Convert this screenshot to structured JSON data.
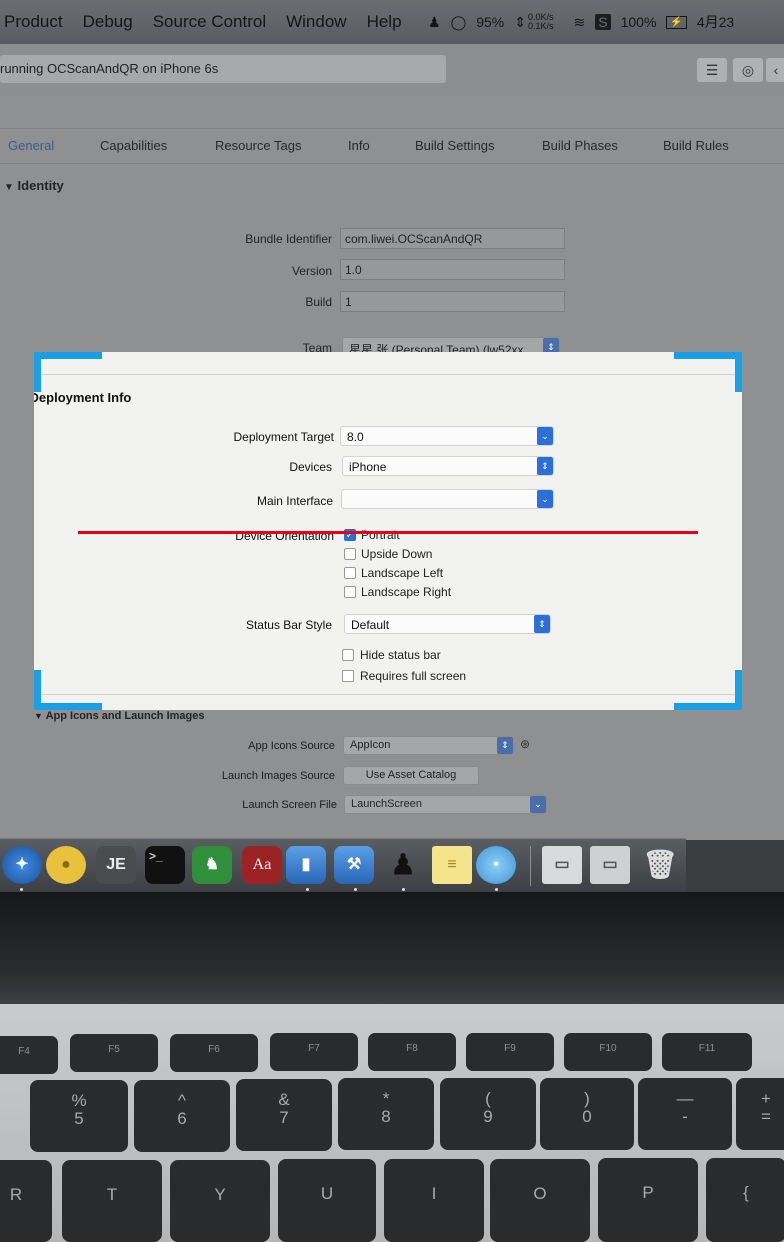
{
  "menubar": {
    "items": [
      "Product",
      "Debug",
      "Source Control",
      "Window",
      "Help"
    ],
    "battery_status": "95%",
    "net_up": "0.0K/s",
    "net_down": "0.1K/s",
    "battery": "100%",
    "date": "4月23"
  },
  "toolbar": {
    "scheme_status": "running OCScanAndQR on iPhone 6s"
  },
  "tabs": [
    "General",
    "Capabilities",
    "Resource Tags",
    "Info",
    "Build Settings",
    "Build Phases",
    "Build Rules"
  ],
  "identity": {
    "title": "Identity",
    "bundle_label": "Bundle Identifier",
    "bundle_value": "com.liwei.OCScanAndQR",
    "version_label": "Version",
    "version_value": "1.0",
    "build_label": "Build",
    "build_value": "1",
    "team_label": "Team",
    "team_value": "星星 张 (Personal Team) (lw52xx..."
  },
  "deployment": {
    "title": "Deployment Info",
    "target_label": "Deployment Target",
    "target_value": "8.0",
    "devices_label": "Devices",
    "devices_value": "iPhone",
    "main_interface_label": "Main Interface",
    "main_interface_value": "",
    "orientation_label": "Device Orientation",
    "orientations": [
      "Portrait",
      "Upside Down",
      "Landscape Left",
      "Landscape Right"
    ],
    "status_bar_label": "Status Bar Style",
    "status_bar_value": "Default",
    "hide_status_bar": "Hide status bar",
    "requires_full_screen": "Requires full screen"
  },
  "app_icons": {
    "title": "App Icons and Launch Images",
    "icons_source_label": "App Icons Source",
    "icons_source_value": "AppIcon",
    "launch_images_label": "Launch Images Source",
    "launch_images_button": "Use Asset Catalog",
    "launch_screen_label": "Launch Screen File",
    "launch_screen_value": "LaunchScreen"
  },
  "dock": {
    "je_label": "JE",
    "terminal_label": ">_",
    "dict_label": "Aa"
  },
  "keyboard": {
    "fkeys": [
      "F4",
      "F5",
      "F6",
      "F7",
      "F8",
      "F9",
      "F10",
      "F11"
    ],
    "numbers": [
      {
        "top": "%",
        "bottom": "5"
      },
      {
        "top": "^",
        "bottom": "6"
      },
      {
        "top": "&",
        "bottom": "7"
      },
      {
        "top": "*",
        "bottom": "8"
      },
      {
        "top": "(",
        "bottom": "9"
      },
      {
        "top": ")",
        "bottom": "0"
      },
      {
        "top": "—",
        "bottom": "-"
      },
      {
        "top": "+",
        "bottom": "="
      }
    ],
    "letters": [
      "R",
      "T",
      "Y",
      "U",
      "I",
      "O",
      "P",
      "{"
    ]
  },
  "colors": {
    "scan_corner": "#1a9fe6",
    "scan_line": "#e60012",
    "xcode_blue": "#2c6fd6"
  }
}
